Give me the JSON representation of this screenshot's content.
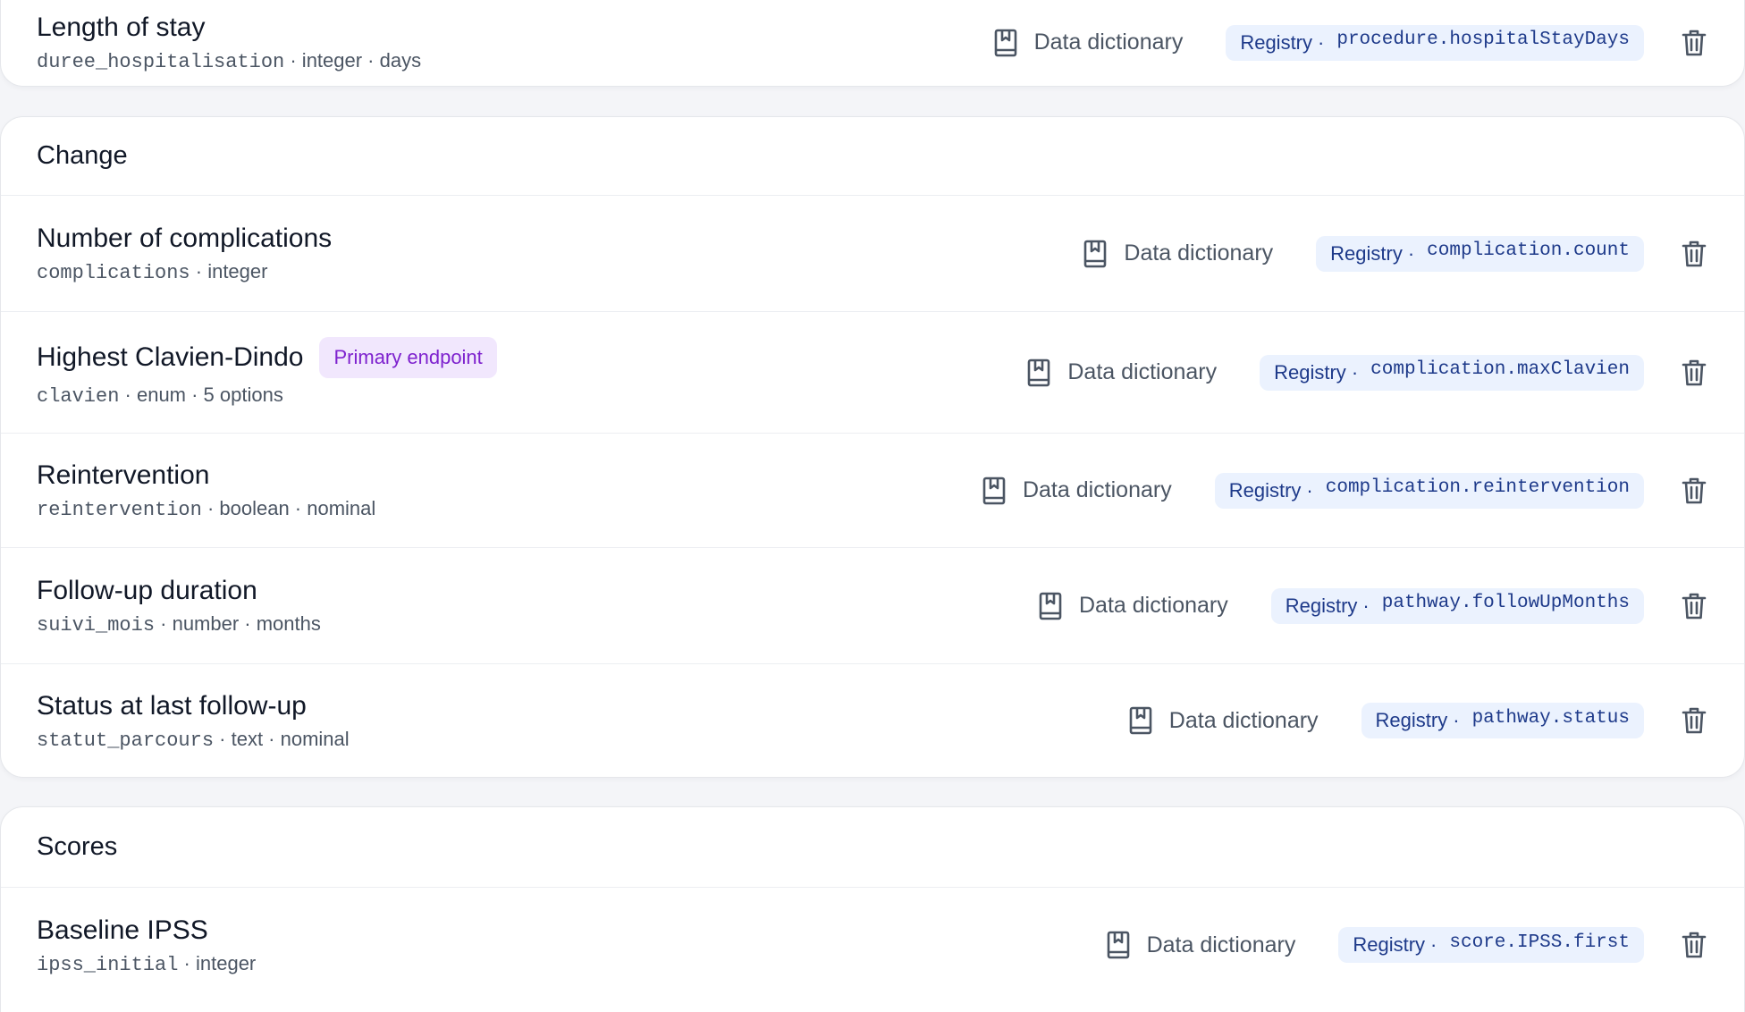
{
  "cards": {
    "top": {
      "rows": [
        {
          "title": "Length of stay",
          "code": "duree_hospitalisation",
          "meta_rest": " · integer · days",
          "dict_label": "Data dictionary",
          "registry_label": "Registry",
          "registry_sep": "·",
          "registry_path": "procedure.hospitalStayDays"
        }
      ]
    },
    "change": {
      "heading": "Change",
      "rows": [
        {
          "title": "Number of complications",
          "code": "complications",
          "meta_rest": " · integer",
          "dict_label": "Data dictionary",
          "registry_label": "Registry",
          "registry_sep": "·",
          "registry_path": "complication.count"
        },
        {
          "title": "Highest Clavien-Dindo",
          "badge": "Primary endpoint",
          "code": "clavien",
          "meta_rest": " · enum · 5 options",
          "dict_label": "Data dictionary",
          "registry_label": "Registry",
          "registry_sep": "·",
          "registry_path": "complication.maxClavien"
        },
        {
          "title": "Reintervention",
          "code": "reintervention",
          "meta_rest": " · boolean · nominal",
          "dict_label": "Data dictionary",
          "registry_label": "Registry",
          "registry_sep": "·",
          "registry_path": "complication.reintervention"
        },
        {
          "title": "Follow-up duration",
          "code": "suivi_mois",
          "meta_rest": " · number · months",
          "dict_label": "Data dictionary",
          "registry_label": "Registry",
          "registry_sep": "·",
          "registry_path": "pathway.followUpMonths"
        },
        {
          "title": "Status at last follow-up",
          "code": "statut_parcours",
          "meta_rest": " · text · nominal",
          "dict_label": "Data dictionary",
          "registry_label": "Registry",
          "registry_sep": "·",
          "registry_path": "pathway.status"
        }
      ]
    },
    "scores": {
      "heading": "Scores",
      "rows": [
        {
          "title": "Baseline IPSS",
          "code": "ipss_initial",
          "meta_rest": " · integer",
          "dict_label": "Data dictionary",
          "registry_label": "Registry",
          "registry_sep": "·",
          "registry_path": "score.IPSS.first"
        }
      ]
    }
  },
  "icons": {
    "dictionary": "book-bookmark-icon",
    "delete": "trash-icon"
  },
  "colors": {
    "registry_bg": "#ebf2fe",
    "registry_text": "#1e3a8a",
    "badge_bg": "#f1e7fd",
    "badge_text": "#7e22ce"
  }
}
